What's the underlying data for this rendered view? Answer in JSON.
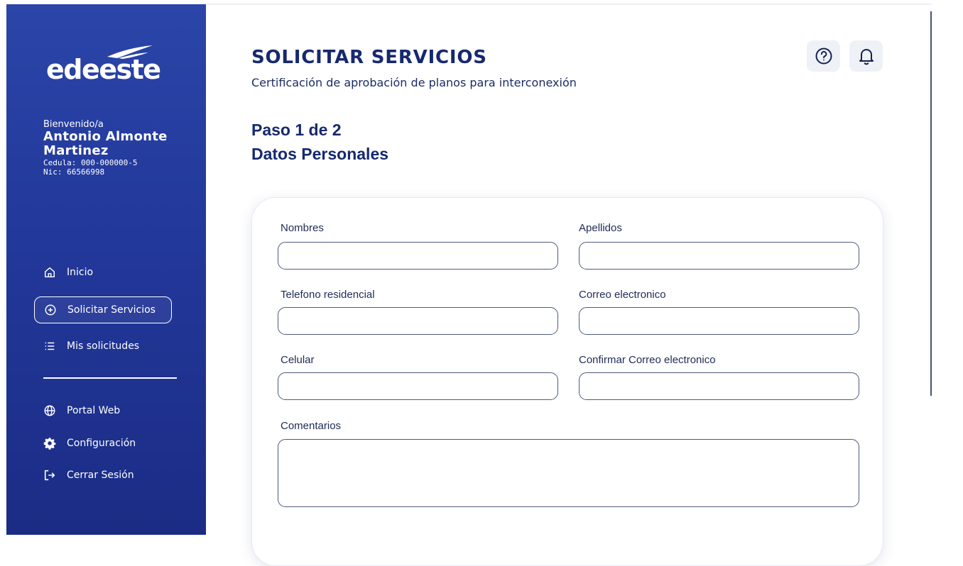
{
  "brand": {
    "logo_text": "edeeste"
  },
  "user": {
    "greeting": "Bienvenido/a",
    "name_line1": "Antonio Almonte",
    "name_line2": "Martinez",
    "cedula": "Cedula: 000-000000-5",
    "nic": "Nic: 66566998"
  },
  "nav": {
    "primary": [
      {
        "label": "Inicio",
        "icon": "home-icon"
      },
      {
        "label": "Solicitar Servicios",
        "icon": "plus-circle-icon",
        "active": true
      },
      {
        "label": "Mis solicitudes",
        "icon": "list-icon"
      }
    ],
    "secondary": [
      {
        "label": "Portal Web",
        "icon": "globe-icon"
      },
      {
        "label": "Configuración",
        "icon": "gear-icon"
      },
      {
        "label": "Cerrar Sesión",
        "icon": "logout-icon"
      }
    ]
  },
  "header": {
    "title": "SOLICITAR SERVICIOS",
    "subtitle": "Certificación de aprobación de planos para interconexión",
    "help_icon": "help-icon",
    "notification_icon": "bell-icon"
  },
  "step": {
    "progress": "Paso 1 de 2",
    "section": "Datos Personales"
  },
  "form": {
    "nombres": {
      "label": "Nombres",
      "value": ""
    },
    "apellidos": {
      "label": "Apellidos",
      "value": ""
    },
    "telefono": {
      "label": "Telefono residencial",
      "value": ""
    },
    "correo": {
      "label": "Correo electronico",
      "value": ""
    },
    "celular": {
      "label": "Celular",
      "value": ""
    },
    "confirmar_correo": {
      "label": "Confirmar Correo electronico",
      "value": ""
    },
    "comentarios": {
      "label": "Comentarios",
      "value": ""
    }
  },
  "colors": {
    "sidebar": "#22389a",
    "title": "#16296f",
    "input_border": "#4d5a80"
  }
}
